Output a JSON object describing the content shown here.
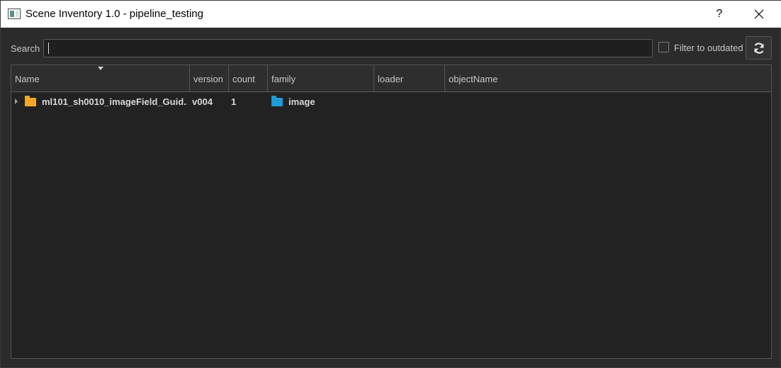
{
  "window": {
    "title": "Scene Inventory 1.0 - pipeline_testing",
    "help_label": "?",
    "close_label": "✕"
  },
  "toolbar": {
    "search_label": "Search",
    "search_value": "",
    "filter_label": "Filter to outdated",
    "filter_checked": false
  },
  "table": {
    "columns": [
      "Name",
      "version",
      "count",
      "family",
      "loader",
      "objectName"
    ],
    "sorted_column": "Name",
    "rows": [
      {
        "name": "ml101_sh0010_imageField_Guid...",
        "version": "v004",
        "count": "1",
        "family": "image",
        "loader": "",
        "objectName": ""
      }
    ]
  },
  "colors": {
    "name_folder": "#f5a623",
    "family_folder": "#1e9bd7"
  },
  "icons": {
    "refresh": "refresh-icon",
    "name_folder": "folder-icon",
    "family_folder": "folder-icon"
  }
}
